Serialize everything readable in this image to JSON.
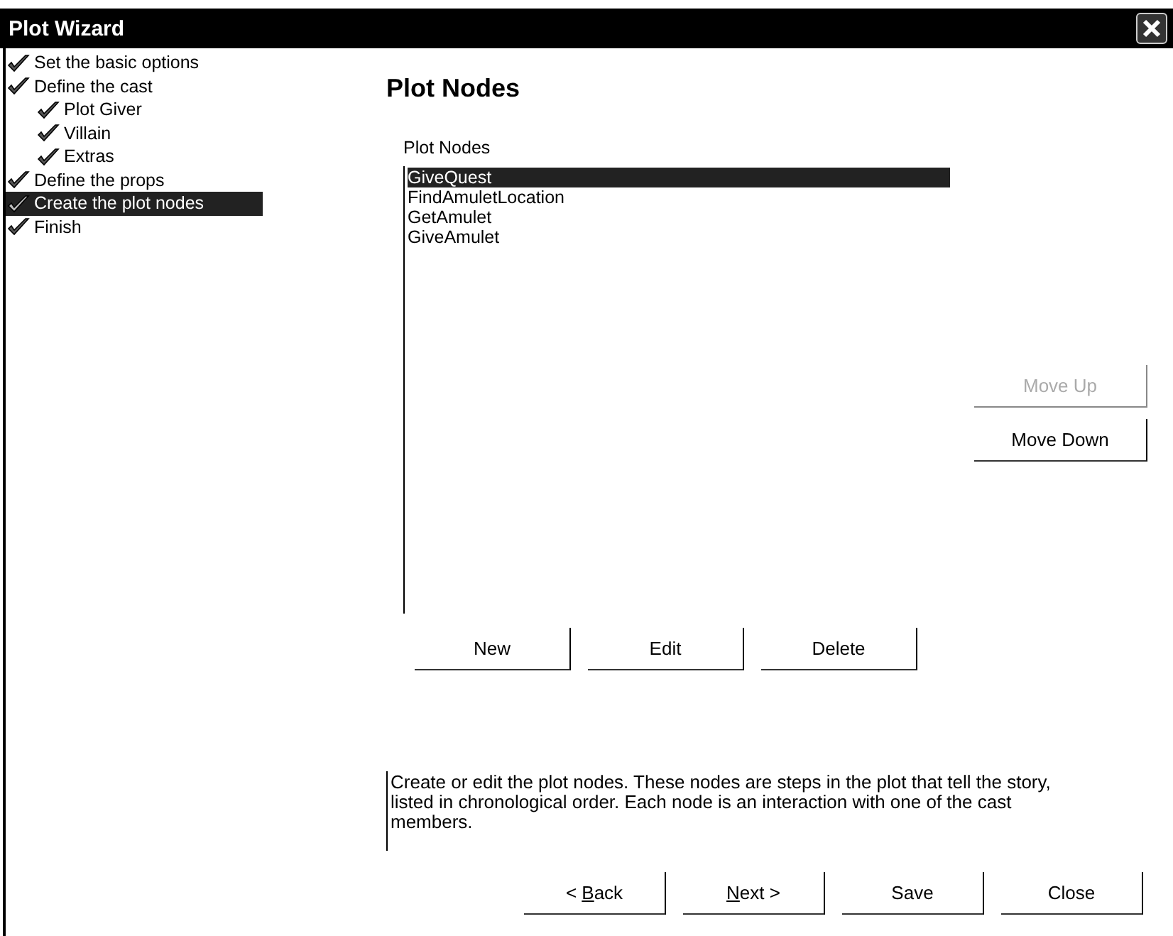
{
  "window": {
    "title": "Plot Wizard"
  },
  "steps": [
    {
      "label": "Set the basic options",
      "selected": false
    },
    {
      "label": "Define the cast",
      "selected": false,
      "children": [
        {
          "label": "Plot Giver",
          "selected": false
        },
        {
          "label": "Villain",
          "selected": false
        },
        {
          "label": "Extras",
          "selected": false
        }
      ]
    },
    {
      "label": "Define the props",
      "selected": false
    },
    {
      "label": "Create the plot nodes",
      "selected": true
    },
    {
      "label": "Finish",
      "selected": false
    }
  ],
  "page": {
    "heading": "Plot Nodes",
    "list_label": "Plot Nodes",
    "nodes": [
      {
        "label": "GiveQuest",
        "selected": true
      },
      {
        "label": "FindAmuletLocation",
        "selected": false
      },
      {
        "label": "GetAmulet",
        "selected": false
      },
      {
        "label": "GiveAmulet",
        "selected": false
      }
    ],
    "side_buttons": [
      {
        "label": "Move Up",
        "disabled": true
      },
      {
        "label": "Move Down",
        "disabled": false
      }
    ],
    "list_buttons": [
      {
        "label": "New"
      },
      {
        "label": "Edit"
      },
      {
        "label": "Delete"
      }
    ],
    "description": "Create or edit the plot nodes. These nodes are steps in the plot that tell the story, listed in chronological order. Each node is an interaction with one of the cast members."
  },
  "footer_buttons": [
    {
      "before": "< ",
      "key": "B",
      "after": "ack"
    },
    {
      "key": "N",
      "after": "ext >"
    },
    {
      "label": "Save"
    },
    {
      "label": "Close"
    }
  ]
}
